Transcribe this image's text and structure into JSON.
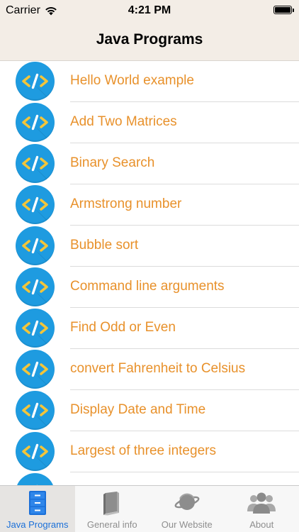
{
  "status_bar": {
    "carrier": "Carrier",
    "time": "4:21 PM"
  },
  "nav": {
    "title": "Java Programs"
  },
  "list": {
    "items": [
      {
        "label": "Hello World example"
      },
      {
        "label": "Add Two Matrices"
      },
      {
        "label": "Binary Search"
      },
      {
        "label": "Armstrong number"
      },
      {
        "label": "Bubble sort"
      },
      {
        "label": "Command line arguments"
      },
      {
        "label": "Find Odd or Even"
      },
      {
        "label": "convert Fahrenheit to Celsius"
      },
      {
        "label": "Display Date and Time"
      },
      {
        "label": "Largest of three integers"
      },
      {
        "label": ""
      }
    ]
  },
  "tabbar": {
    "tabs": [
      {
        "label": "Java Programs",
        "icon": "file-cabinet-icon",
        "active": true
      },
      {
        "label": "General info",
        "icon": "book-icon",
        "active": false
      },
      {
        "label": "Our Website",
        "icon": "planet-icon",
        "active": false
      },
      {
        "label": "About",
        "icon": "people-icon",
        "active": false
      }
    ]
  },
  "colors": {
    "accent_orange": "#e8912b",
    "icon_blue": "#1e9be0",
    "tab_active_blue": "#1a6fd8",
    "header_bg": "#f3ede6"
  }
}
